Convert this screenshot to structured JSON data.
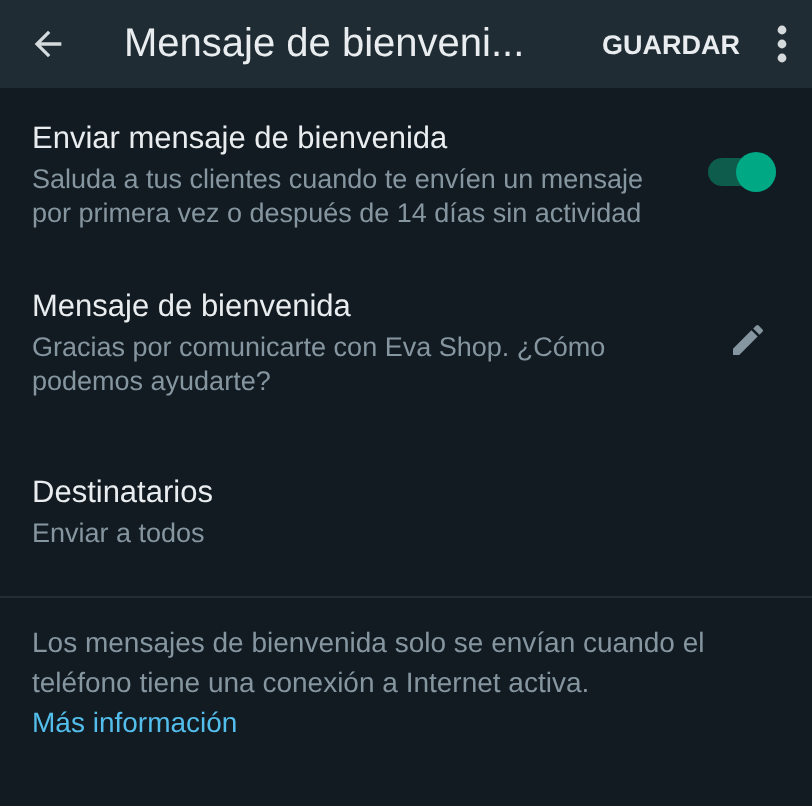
{
  "app_bar": {
    "title": "Mensaje de bienveni...",
    "action": "GUARDAR"
  },
  "settings": [
    {
      "kind": "toggle",
      "title": "Enviar mensaje de bienvenida",
      "subtitle": "Saluda a tus clientes cuando te envíen un mensaje por primera vez o después de 14 días sin actividad",
      "on": true
    },
    {
      "kind": "edit",
      "title": "Mensaje de bienvenida",
      "subtitle": "Gracias por comunicarte con Eva Shop. ¿Cómo podemos ayudarte?"
    },
    {
      "kind": "plain",
      "title": "Destinatarios",
      "subtitle": "Enviar a todos"
    }
  ],
  "footer": {
    "text": "Los mensajes de bienvenida solo se envían cuando el teléfono tiene una conexión a Internet activa.",
    "link": "Más información"
  }
}
